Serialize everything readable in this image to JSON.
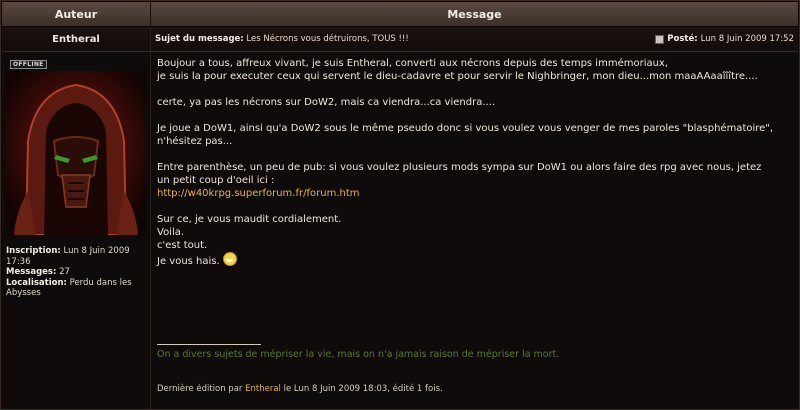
{
  "table": {
    "header_author": "Auteur",
    "header_message": "Message"
  },
  "author": {
    "name": "Entheral",
    "status": "OFFLINE",
    "inscription_label": "Inscription:",
    "inscription_value": "Lun 8 Juin 2009 17:36",
    "messages_label": "Messages:",
    "messages_value": "27",
    "localisation_label": "Localisation:",
    "localisation_value": "Perdu dans les Abysses"
  },
  "post": {
    "subject_label": "Sujet du message:",
    "subject_value": "Les Nécrons vous détruirons, TOUS !!!",
    "posted_label": "Posté:",
    "posted_value": "Lun 8 Juin 2009 17:52",
    "lines": {
      "l1": "Boujour a tous, affreux vivant, je suis Entheral, converti aux nécrons depuis des temps immémoriaux,",
      "l2": "je suis la pour executer ceux qui servent le dieu-cadavre et pour servir le Nighbringer, mon dieu...mon maaAAaaîîître....",
      "l3": "certe, ya pas les nécrons sur DoW2, mais ca viendra...ca viendra....",
      "l4": "Je joue a DoW1, ainsi qu'a DoW2 sous le même pseudo donc si vous voulez vous venger de mes paroles \"blasphématoire\",",
      "l5": "n'hésitez pas...",
      "l6": "Entre parenthèse, un peu de pub: si vous voulez plusieurs mods sympa sur DoW1 ou alors faire des rpg avec nous, jetez",
      "l7": "un petit coup d'oeil ici :",
      "link": "http://w40krpg.superforum.fr/forum.htm",
      "l8": "Sur ce, je vous maudit cordialement.",
      "l9": "Voila.",
      "l10": "c'est tout.",
      "l11": "Je vous hais."
    },
    "signature": "On a divers sujets de mépriser la vie, mais on n'a jamais raison de mépriser la mort.",
    "edit_prefix": "Dernière édition par",
    "edit_user": "Entheral",
    "edit_suffix": "le Lun 8 Juin 2009 18:03, édité 1 fois."
  }
}
